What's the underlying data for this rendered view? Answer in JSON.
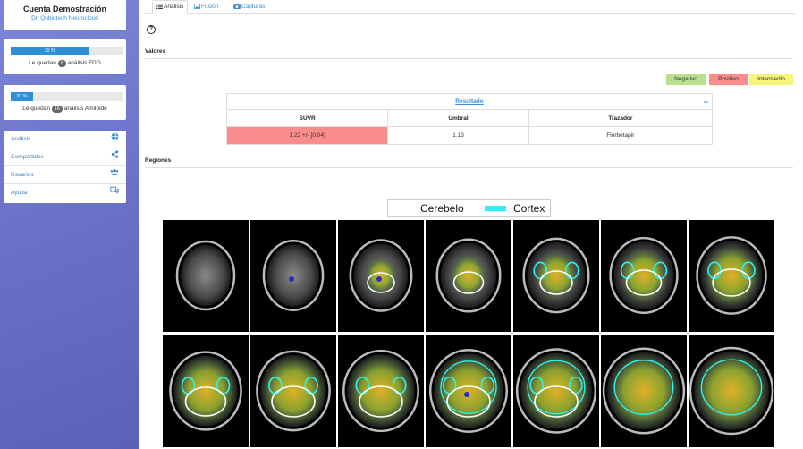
{
  "sidebar": {
    "account_name": "Cuenta Demostración",
    "account_sub": "Dr. Qubiotech Neurocloud",
    "quotas": [
      {
        "percent": 70,
        "label": "70 %",
        "prefix": "Le quedan",
        "count": "6",
        "suffix": "análisis FDG"
      },
      {
        "percent": 20,
        "label": "20 %",
        "prefix": "Le quedan",
        "count": "16",
        "suffix": "análisis Amiloide"
      }
    ],
    "nav": [
      {
        "label": "Análisis",
        "icon": "globe-icon"
      },
      {
        "label": "Compartidos",
        "icon": "share-icon"
      },
      {
        "label": "Usuarios",
        "icon": "users-icon"
      },
      {
        "label": "Ayuda",
        "icon": "chat-icon"
      }
    ]
  },
  "tabs": [
    {
      "label": "Análisis",
      "icon": "list-icon",
      "active": true
    },
    {
      "label": "Fusión",
      "icon": "image-icon",
      "active": false
    },
    {
      "label": "Capturas",
      "icon": "camera-icon",
      "active": false
    }
  ],
  "help_symbol": "?",
  "sections": {
    "valores": "Valores",
    "regiones": "Regiones"
  },
  "legend_badges": [
    {
      "label": "Negativo",
      "color": "#b9e08c"
    },
    {
      "label": "Positivo",
      "color": "#fa8c8c"
    },
    {
      "label": "Intermedio",
      "color": "#f5f57a"
    }
  ],
  "result": {
    "title": "Resultado",
    "expand_symbol": "+",
    "headers": [
      "SUVR",
      "Umbral",
      "Trazador"
    ],
    "row": [
      "1.22 +/- [0.04]",
      "1.13",
      "Florbetapir"
    ],
    "status_color": "#fa8c8c"
  },
  "figure": {
    "legend": [
      {
        "label": "Cerebelo",
        "color": "#ffffff"
      },
      {
        "label": "Cortex",
        "color": "#2ef2f2"
      }
    ],
    "rows": 2,
    "cols": 7
  }
}
